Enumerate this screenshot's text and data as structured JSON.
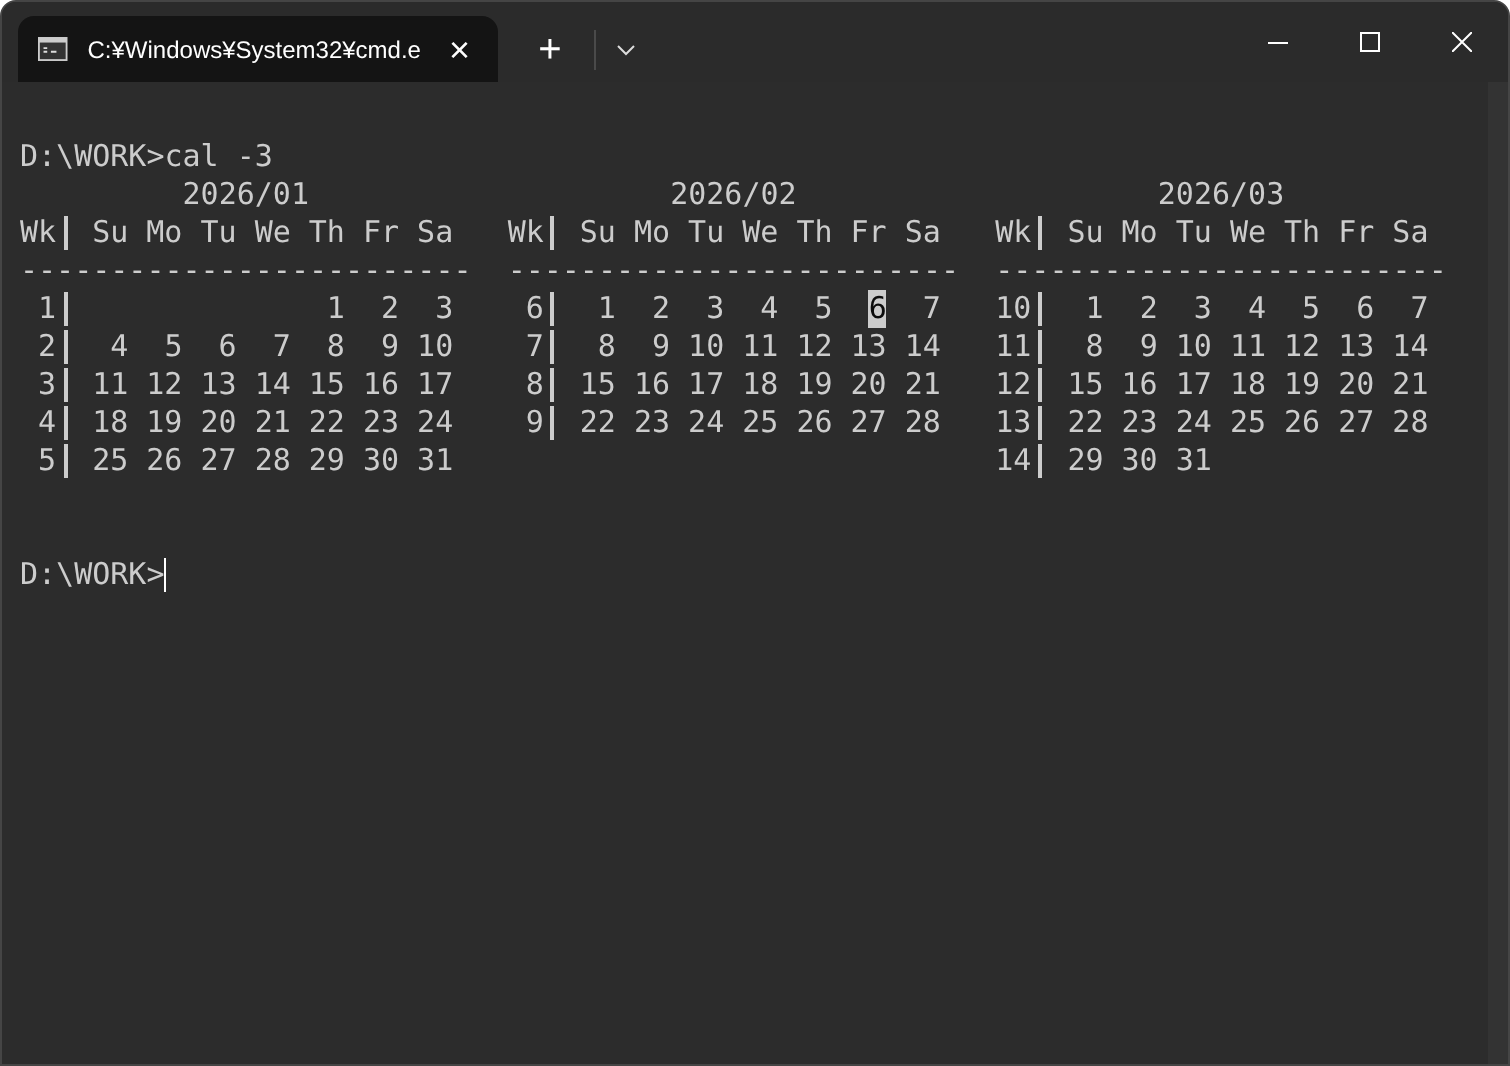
{
  "tab": {
    "title": "C:¥Windows¥System32¥cmd.e",
    "close": "×"
  },
  "new_tab": "+",
  "command_line": {
    "prompt": "D:\\WORK>",
    "command": "cal -3"
  },
  "months": [
    {
      "title": "2026/01",
      "week_header": "Wk",
      "days_header": [
        "Su",
        "Mo",
        "Tu",
        "We",
        "Th",
        "Fr",
        "Sa"
      ],
      "rule": "-------------------------",
      "weeks": [
        {
          "week": "1",
          "kind": "start",
          "days": [
            {
              "d": "1",
              "today": false
            },
            {
              "d": "2",
              "today": false
            },
            {
              "d": "3",
              "today": false
            }
          ]
        },
        {
          "week": "2",
          "days": [
            {
              "d": "4",
              "today": false
            },
            {
              "d": "5",
              "today": false
            },
            {
              "d": "6",
              "today": false
            },
            {
              "d": "7",
              "today": false
            },
            {
              "d": "8",
              "today": false
            },
            {
              "d": "9",
              "today": false
            },
            {
              "d": "10",
              "today": false
            }
          ]
        },
        {
          "week": "3",
          "days": [
            {
              "d": "11",
              "today": false
            },
            {
              "d": "12",
              "today": false
            },
            {
              "d": "13",
              "today": false
            },
            {
              "d": "14",
              "today": false
            },
            {
              "d": "15",
              "today": false
            },
            {
              "d": "16",
              "today": false
            },
            {
              "d": "17",
              "today": false
            }
          ]
        },
        {
          "week": "4",
          "days": [
            {
              "d": "18",
              "today": false
            },
            {
              "d": "19",
              "today": false
            },
            {
              "d": "20",
              "today": false
            },
            {
              "d": "21",
              "today": false
            },
            {
              "d": "22",
              "today": false
            },
            {
              "d": "23",
              "today": false
            },
            {
              "d": "24",
              "today": false
            }
          ]
        },
        {
          "week": "5",
          "days": [
            {
              "d": "25",
              "today": false
            },
            {
              "d": "26",
              "today": false
            },
            {
              "d": "27",
              "today": false
            },
            {
              "d": "28",
              "today": false
            },
            {
              "d": "29",
              "today": false
            },
            {
              "d": "30",
              "today": false
            },
            {
              "d": "31",
              "today": false
            }
          ]
        }
      ]
    },
    {
      "title": "2026/02",
      "week_header": "Wk",
      "days_header": [
        "Su",
        "Mo",
        "Tu",
        "We",
        "Th",
        "Fr",
        "Sa"
      ],
      "rule": "-------------------------",
      "weeks": [
        {
          "week": "6",
          "days": [
            {
              "d": "1",
              "today": false
            },
            {
              "d": "2",
              "today": false
            },
            {
              "d": "3",
              "today": false
            },
            {
              "d": "4",
              "today": false
            },
            {
              "d": "5",
              "today": false
            },
            {
              "d": "6",
              "today": true
            },
            {
              "d": "7",
              "today": false
            }
          ]
        },
        {
          "week": "7",
          "days": [
            {
              "d": "8",
              "today": false
            },
            {
              "d": "9",
              "today": false
            },
            {
              "d": "10",
              "today": false
            },
            {
              "d": "11",
              "today": false
            },
            {
              "d": "12",
              "today": false
            },
            {
              "d": "13",
              "today": false
            },
            {
              "d": "14",
              "today": false
            }
          ]
        },
        {
          "week": "8",
          "days": [
            {
              "d": "15",
              "today": false
            },
            {
              "d": "16",
              "today": false
            },
            {
              "d": "17",
              "today": false
            },
            {
              "d": "18",
              "today": false
            },
            {
              "d": "19",
              "today": false
            },
            {
              "d": "20",
              "today": false
            },
            {
              "d": "21",
              "today": false
            }
          ]
        },
        {
          "week": "9",
          "days": [
            {
              "d": "22",
              "today": false
            },
            {
              "d": "23",
              "today": false
            },
            {
              "d": "24",
              "today": false
            },
            {
              "d": "25",
              "today": false
            },
            {
              "d": "26",
              "today": false
            },
            {
              "d": "27",
              "today": false
            },
            {
              "d": "28",
              "today": false
            }
          ]
        }
      ]
    },
    {
      "title": "2026/03",
      "week_header": "Wk",
      "days_header": [
        "Su",
        "Mo",
        "Tu",
        "We",
        "Th",
        "Fr",
        "Sa"
      ],
      "rule": "-------------------------",
      "weeks": [
        {
          "week": "10",
          "days": [
            {
              "d": "1",
              "today": false
            },
            {
              "d": "2",
              "today": false
            },
            {
              "d": "3",
              "today": false
            },
            {
              "d": "4",
              "today": false
            },
            {
              "d": "5",
              "today": false
            },
            {
              "d": "6",
              "today": false
            },
            {
              "d": "7",
              "today": false
            }
          ]
        },
        {
          "week": "11",
          "days": [
            {
              "d": "8",
              "today": false
            },
            {
              "d": "9",
              "today": false
            },
            {
              "d": "10",
              "today": false
            },
            {
              "d": "11",
              "today": false
            },
            {
              "d": "12",
              "today": false
            },
            {
              "d": "13",
              "today": false
            },
            {
              "d": "14",
              "today": false
            }
          ]
        },
        {
          "week": "12",
          "days": [
            {
              "d": "15",
              "today": false
            },
            {
              "d": "16",
              "today": false
            },
            {
              "d": "17",
              "today": false
            },
            {
              "d": "18",
              "today": false
            },
            {
              "d": "19",
              "today": false
            },
            {
              "d": "20",
              "today": false
            },
            {
              "d": "21",
              "today": false
            }
          ]
        },
        {
          "week": "13",
          "days": [
            {
              "d": "22",
              "today": false
            },
            {
              "d": "23",
              "today": false
            },
            {
              "d": "24",
              "today": false
            },
            {
              "d": "25",
              "today": false
            },
            {
              "d": "26",
              "today": false
            },
            {
              "d": "27",
              "today": false
            },
            {
              "d": "28",
              "today": false
            }
          ]
        },
        {
          "week": "14",
          "days": [
            {
              "d": "29",
              "today": false
            },
            {
              "d": "30",
              "today": false
            },
            {
              "d": "31",
              "today": false
            }
          ],
          "kind": "end"
        }
      ]
    }
  ],
  "prompt_line": {
    "prompt": "D:\\WORK>",
    "cursor": true
  }
}
